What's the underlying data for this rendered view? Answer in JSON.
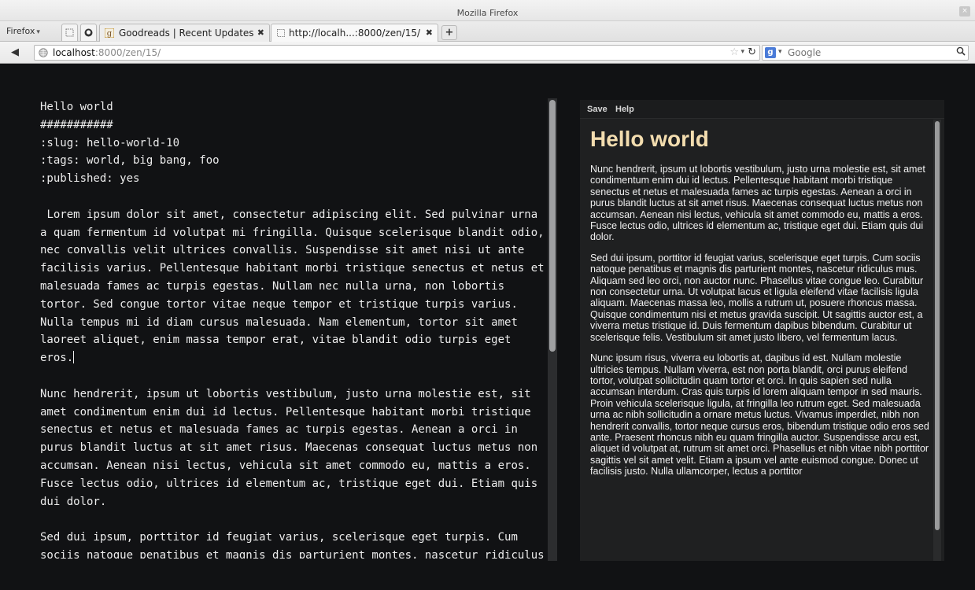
{
  "window": {
    "title": "Mozilla Firefox",
    "close": "×"
  },
  "tabstrip": {
    "menu_label": "Firefox",
    "tabs": [
      {
        "label": "Goodreads | Recent Updates",
        "close": "✖"
      },
      {
        "label": "http://localh...:8000/zen/15/",
        "close": "✖"
      }
    ],
    "new_tab": "+"
  },
  "navbar": {
    "back": "◀",
    "url_host": "localhost",
    "url_path": ":8000/zen/15/",
    "bookmark_star": "☆",
    "reload": "↻",
    "search_engine": "g",
    "search_placeholder": "Google",
    "search_icon": "🔍"
  },
  "editor": {
    "text": "Hello world\n###########\n:slug: hello-world-10\n:tags: world, big bang, foo\n:published: yes\n\n Lorem ipsum dolor sit amet, consectetur adipiscing elit. Sed pulvinar urna a quam fermentum id volutpat mi fringilla. Quisque scelerisque blandit odio, nec convallis velit ultrices convallis. Suspendisse sit amet nisi ut ante facilisis varius. Pellentesque habitant morbi tristique senectus et netus et malesuada fames ac turpis egestas. Nullam nec nulla urna, non lobortis tortor. Sed congue tortor vitae neque tempor et tristique turpis varius. Nulla tempus mi id diam cursus malesuada. Nam elementum, tortor sit amet laoreet aliquet, enim massa tempor erat, vitae blandit odio turpis eget eros.",
    "text_after_caret": "\n\nNunc hendrerit, ipsum ut lobortis vestibulum, justo urna molestie est, sit amet condimentum enim dui id lectus. Pellentesque habitant morbi tristique senectus et netus et malesuada fames ac turpis egestas. Aenean a orci in purus blandit luctus at sit amet risus. Maecenas consequat luctus metus non accumsan. Aenean nisi lectus, vehicula sit amet commodo eu, mattis a eros. Fusce lectus odio, ultrices id elementum ac, tristique eget dui. Etiam quis dui dolor.\n\nSed dui ipsum, porttitor id feugiat varius, scelerisque eget turpis. Cum sociis natoque penatibus et magnis dis parturient montes, nascetur ridiculus mus. Aliquam sed leo orci, non auctor nunc. Phasellus vitae"
  },
  "preview": {
    "toolbar": {
      "save": "Save",
      "help": "Help"
    },
    "title": "Hello world",
    "paragraphs": [
      "Nunc hendrerit, ipsum ut lobortis vestibulum, justo urna molestie est, sit amet condimentum enim dui id lectus. Pellentesque habitant morbi tristique senectus et netus et malesuada fames ac turpis egestas. Aenean a orci in purus blandit luctus at sit amet risus. Maecenas consequat luctus metus non accumsan. Aenean nisi lectus, vehicula sit amet commodo eu, mattis a eros. Fusce lectus odio, ultrices id elementum ac, tristique eget dui. Etiam quis dui dolor.",
      "Sed dui ipsum, porttitor id feugiat varius, scelerisque eget turpis. Cum sociis natoque penatibus et magnis dis parturient montes, nascetur ridiculus mus. Aliquam sed leo orci, non auctor nunc. Phasellus vitae congue leo. Curabitur non consectetur urna. Ut volutpat lacus et ligula eleifend vitae facilisis ligula aliquam. Maecenas massa leo, mollis a rutrum ut, posuere rhoncus massa. Quisque condimentum nisi et metus gravida suscipit. Ut sagittis auctor est, a viverra metus tristique id. Duis fermentum dapibus bibendum. Curabitur ut scelerisque felis. Vestibulum sit amet justo libero, vel fermentum lacus.",
      "Nunc ipsum risus, viverra eu lobortis at, dapibus id est. Nullam molestie ultricies tempus. Nullam viverra, est non porta blandit, orci purus eleifend tortor, volutpat sollicitudin quam tortor et orci. In quis sapien sed nulla accumsan interdum. Cras quis turpis id lorem aliquam tempor in sed mauris. Proin vehicula scelerisque ligula, at fringilla leo rutrum eget. Sed malesuada urna ac nibh sollicitudin a ornare metus luctus. Vivamus imperdiet, nibh non hendrerit convallis, tortor neque cursus eros, bibendum tristique odio eros sed ante. Praesent rhoncus nibh eu quam fringilla auctor. Suspendisse arcu est, aliquet id volutpat at, rutrum sit amet orci. Phasellus et nibh vitae nibh porttitor sagittis vel sit amet velit. Etiam a ipsum vel ante euismod congue. Donec ut facilisis justo. Nulla ullamcorper, lectus a porttitor"
    ]
  },
  "colors": {
    "page_bg": "#111214",
    "editor_text": "#ececec",
    "preview_bg": "#1f2021",
    "preview_title": "#f3ddaf",
    "goodreads_favicon": "#c59a3e"
  }
}
